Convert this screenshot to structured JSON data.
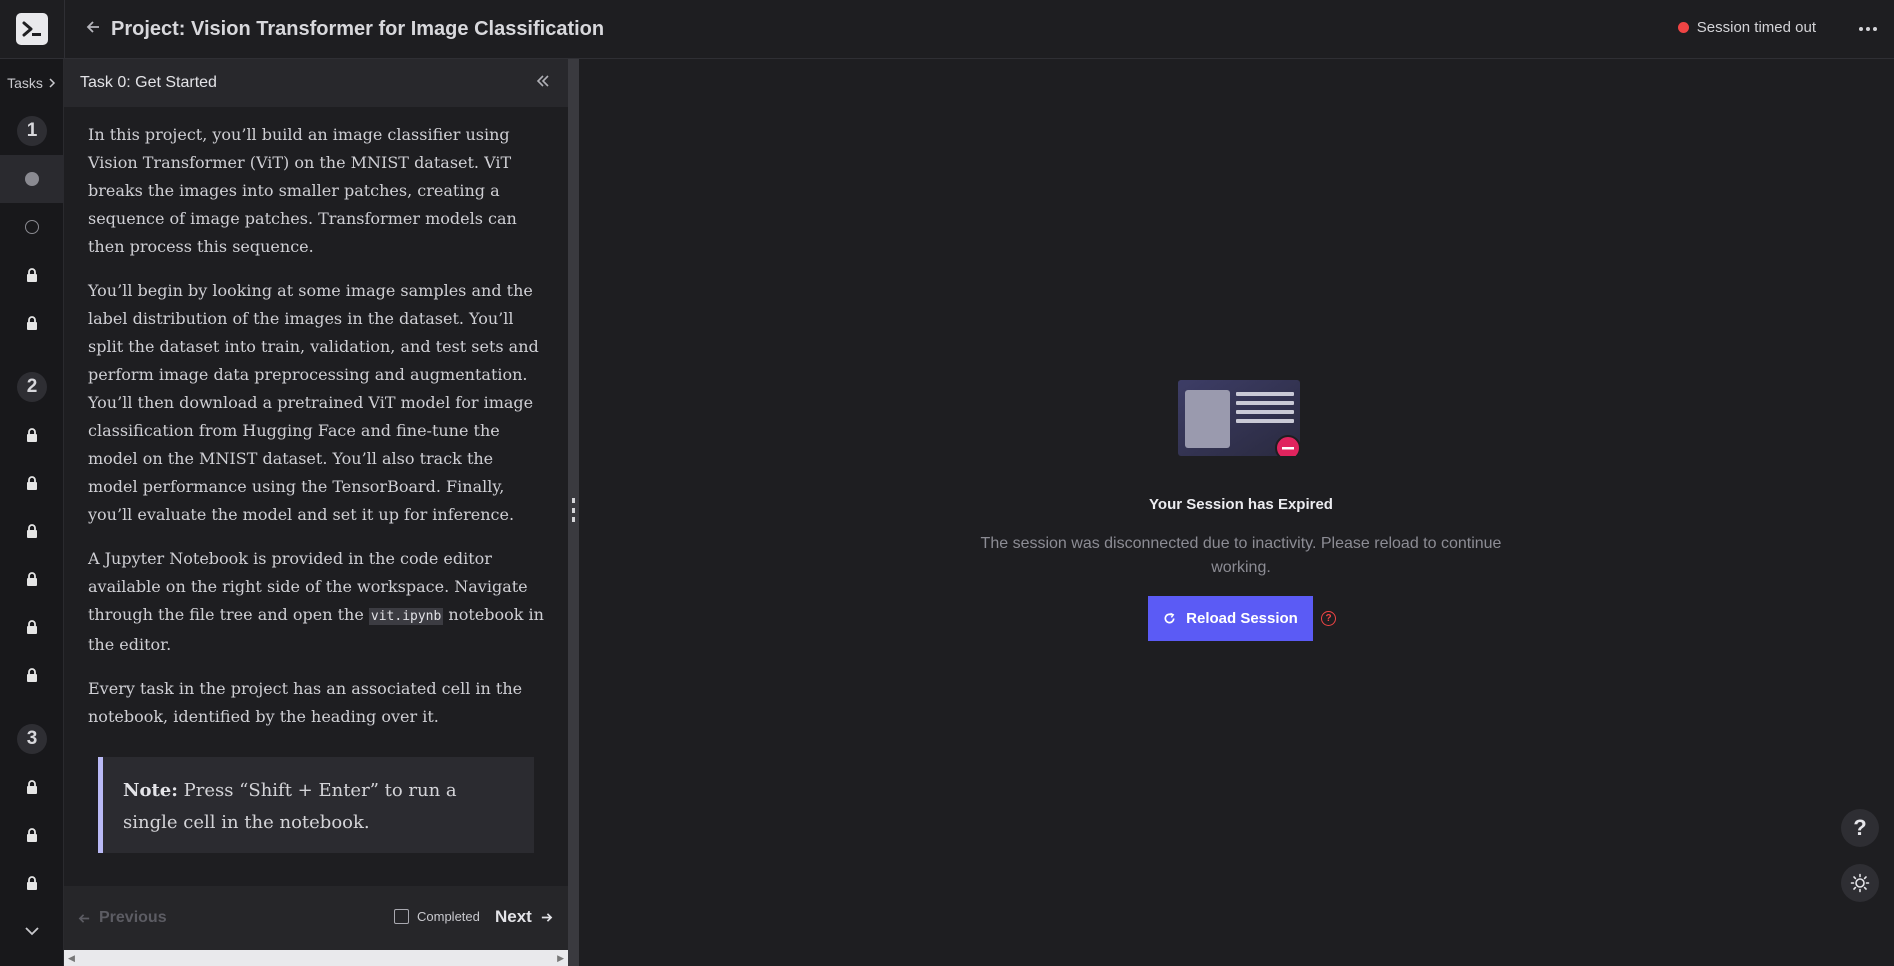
{
  "header": {
    "project_title": "Project: Vision Transformer for Image Classification",
    "session_status": "Session timed out",
    "status_color": "#ef4444"
  },
  "rail": {
    "tasks_label": "Tasks",
    "sections": [
      "1",
      "2",
      "3"
    ]
  },
  "panel": {
    "task_title": "Task 0: Get Started",
    "paragraphs": [
      "In this project, you’ll build an image classifier using Vision Transformer (ViT) on the MNIST dataset. ViT breaks the images into smaller patches, creating a sequence of image patches. Transformer models can then process this sequence.",
      "You’ll begin by looking at some image samples and the label distribution of the images in the dataset. You’ll split the dataset into train, validation, and test sets and perform image data preprocessing and augmentation. You’ll then download a pretrained ViT model for image classification from Hugging Face and fine-tune the model on the MNIST dataset. You’ll also track the model performance using the TensorBoard. Finally, you’ll evaluate the model and set it up for inference.",
      "Every task in the project has an associated cell in the notebook, identified by the heading over it."
    ],
    "p3_before": "A Jupyter Notebook is provided in the code editor available on the right side of the workspace. Navigate through the file tree and open the ",
    "p3_code": "vit.ipynb",
    "p3_after": " notebook in the editor.",
    "note_label": "Note:",
    "note_text": " Press “Shift + Enter” to run a single cell in the notebook."
  },
  "footer": {
    "previous_label": "Previous",
    "completed_label": "Completed",
    "next_label": "Next"
  },
  "main": {
    "expired_title": "Your Session has Expired",
    "expired_desc": "The session was disconnected due to inactivity. Please reload to continue working.",
    "reload_label": "Reload Session",
    "accent_color": "#5b5bf5"
  },
  "fabs": {
    "help_glyph": "?"
  }
}
